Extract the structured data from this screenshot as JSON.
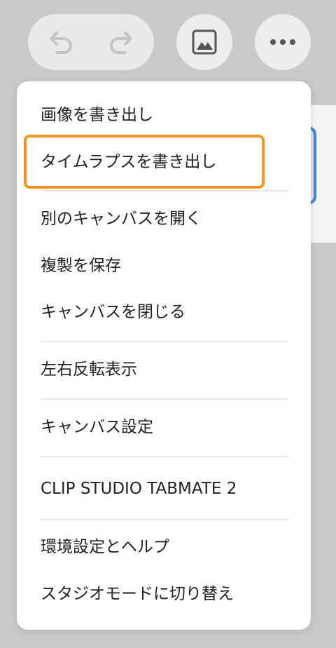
{
  "toolbar": {
    "undo_icon": "undo-icon",
    "redo_icon": "redo-icon",
    "image_icon": "image-icon",
    "more_icon": "more-icon"
  },
  "menu": {
    "items": [
      {
        "label": "画像を書き出し"
      },
      {
        "label": "タイムラプスを書き出し",
        "highlighted": true
      },
      {
        "label": "別のキャンバスを開く"
      },
      {
        "label": "複製を保存"
      },
      {
        "label": "キャンバスを閉じる"
      },
      {
        "label": "左右反転表示"
      },
      {
        "label": "キャンバス設定"
      },
      {
        "label": "CLIP STUDIO TABMATE 2"
      },
      {
        "label": "環境設定とヘルプ"
      },
      {
        "label": "スタジオモードに切り替え"
      }
    ]
  },
  "colors": {
    "highlight": "#f7941d",
    "selection_accent": "#2f8bea",
    "background": "#c9c9c9"
  }
}
